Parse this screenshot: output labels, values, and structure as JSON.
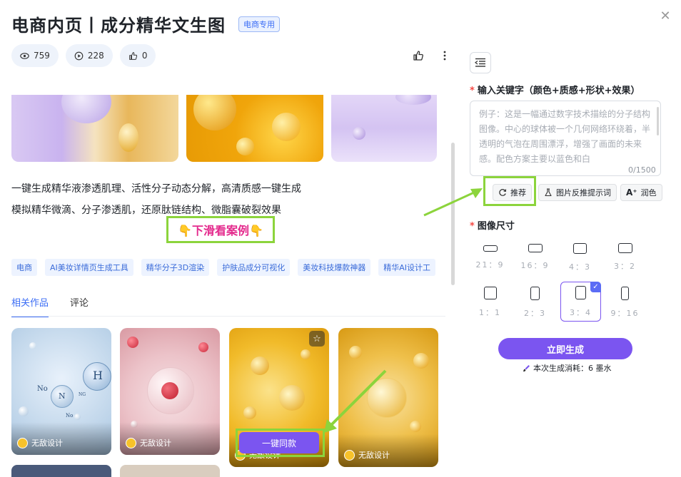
{
  "header": {
    "title": "电商内页丨成分精华文生图",
    "badge": "电商专用"
  },
  "stats": {
    "views": "759",
    "uses": "228",
    "likes": "0"
  },
  "description": {
    "line1": "一键生成精华液渗透肌理、活性分子动态分解，高清质感一键生成",
    "line2": "模拟精华微滴、分子渗透肌，还原肽链结构、微脂囊破裂效果",
    "scroll_hint": "👇下滑看案例👇"
  },
  "tags": [
    "电商",
    "AI美妆详情页生成工具",
    "精华分子3D渲染",
    "护肤品成分可视化",
    "美妆科技爆款神器",
    "精华AI设计工"
  ],
  "tabs": [
    {
      "label": "相关作品",
      "active": true
    },
    {
      "label": "评论",
      "active": false
    }
  ],
  "works": [
    {
      "author": "无敌设计"
    },
    {
      "author": "无敌设计"
    },
    {
      "author": "无敌设计",
      "hover_action": "一键同款"
    },
    {
      "author": "无敌设计"
    }
  ],
  "card1_text": {
    "h_label": "H",
    "n_label": "N",
    "no_label_1": "No",
    "no_label_2": "No",
    "ng_label": "NG"
  },
  "panel": {
    "keyword_label": "输入关键字（颜色+质感+形状+效果）",
    "keyword_placeholder": "例子：这是一幅通过数字技术描绘的分子结构图像。中心的球体被一个几何网络环绕着，半透明的气泡在周围漂浮，增强了画面的未来感。配色方案主要以蓝色和白",
    "keyword_counter": "0/1500",
    "actions": {
      "recommend": "推荐",
      "reverse_prompt": "图片反推提示词",
      "polish": "润色"
    },
    "size_label": "图像尺寸",
    "ratios": [
      "21：9",
      "16：9",
      "4：3",
      "3：2",
      "1：1",
      "2：3",
      "3：4",
      "9：16"
    ],
    "selected_ratio": "3：4",
    "generate_label": "立即生成",
    "cost_text": "本次生成消耗：6 墨水"
  },
  "colors": {
    "accent": "#7b55f0",
    "highlight_frame": "#8cd43c",
    "link_blue": "#3b6df5"
  }
}
